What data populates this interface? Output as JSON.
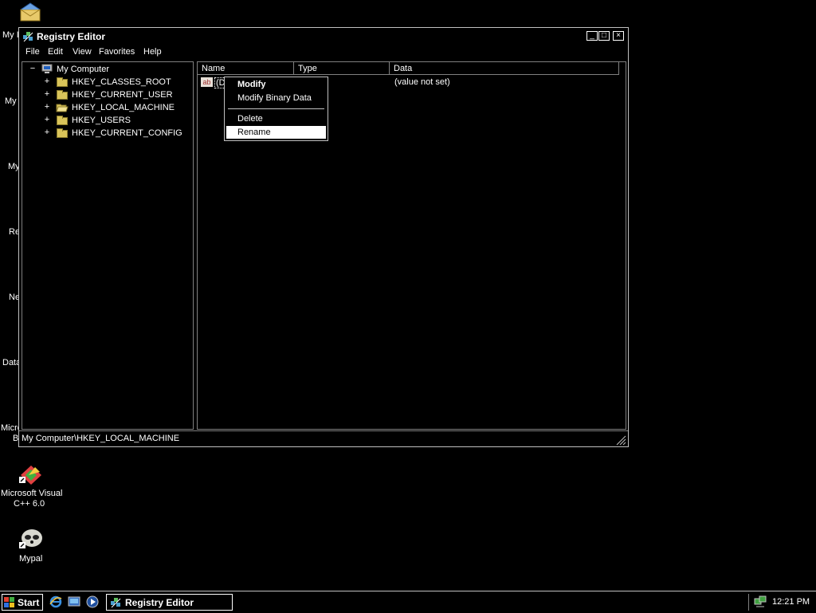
{
  "desktop": {
    "partial_labels": [
      "My I",
      "My",
      "My",
      "Re",
      "Ne",
      "Data",
      "Micro",
      "B"
    ],
    "icons": [
      {
        "line1": "Microsoft Visual",
        "line2": "C++ 6.0"
      },
      {
        "line1": "Mypal",
        "line2": ""
      }
    ]
  },
  "window": {
    "title": "Registry Editor",
    "buttons": {
      "minimize": "_",
      "maximize": "□",
      "close": "×"
    },
    "menu": [
      "File",
      "Edit",
      "View",
      "Favorites",
      "Help"
    ],
    "tree": {
      "root": {
        "expander": "−",
        "label": "My Computer"
      },
      "children": [
        {
          "expander": "+",
          "label": "HKEY_CLASSES_ROOT"
        },
        {
          "expander": "+",
          "label": "HKEY_CURRENT_USER"
        },
        {
          "expander": "+",
          "label": "HKEY_LOCAL_MACHINE"
        },
        {
          "expander": "+",
          "label": "HKEY_USERS"
        },
        {
          "expander": "+",
          "label": "HKEY_CURRENT_CONFIG"
        }
      ]
    },
    "list": {
      "columns": [
        "Name",
        "Type",
        "Data"
      ],
      "rows": [
        {
          "icon": "ab",
          "name": "(D",
          "type": "",
          "data": "(value not set)"
        }
      ]
    },
    "status": "My Computer\\HKEY_LOCAL_MACHINE"
  },
  "context_menu": {
    "items": [
      "Modify",
      "Modify Binary Data",
      "Delete",
      "Rename"
    ],
    "highlighted": "Rename"
  },
  "taskbar": {
    "start_label": "Start",
    "task_label": "Registry Editor",
    "clock": "12:21 PM"
  },
  "colors": {
    "background": "#000000",
    "text": "#ffffff",
    "folder": "#d9c45a",
    "highlight": "#ffffff"
  }
}
